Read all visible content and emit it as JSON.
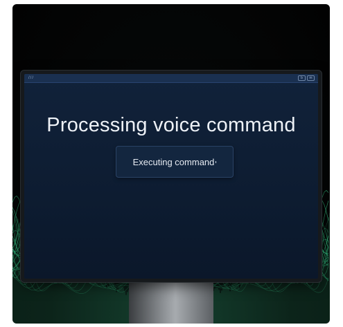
{
  "screen": {
    "headline": "Processing voice command",
    "status": "Executing command"
  },
  "titlebar": {
    "grip": "///",
    "controls": [
      "b",
      "m"
    ]
  },
  "colors": {
    "accent_wave": "#3ddc97",
    "screen_bg": "#0d1c31",
    "text": "#eef2f7"
  }
}
